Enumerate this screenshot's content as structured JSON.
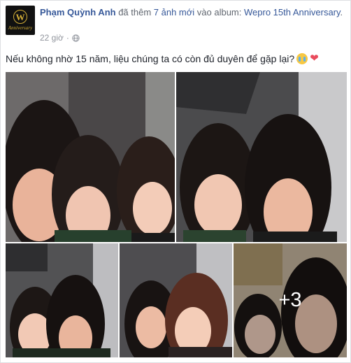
{
  "post": {
    "author": "Phạm Quỳnh Anh",
    "action_text": " đã thêm ",
    "photo_count_link": "7 ảnh mới",
    "preposition": " vào album: ",
    "album_name": "Wepro 15th Anniversary",
    "album_suffix": ".",
    "timestamp": "22 giờ",
    "separator": "·",
    "privacy_icon": "globe-icon",
    "caption": "Nếu không nhờ 15 năm, liệu chúng ta có còn đủ duyên để gặp lại?",
    "caption_emojis": [
      "crying-face-icon",
      "heart-icon"
    ],
    "heart_glyph": "❤",
    "avatar_logo": {
      "monogram": "W",
      "script": "Anniversary"
    },
    "more_photos": "+3"
  },
  "colors": {
    "link": "#365899",
    "meta": "#90949c",
    "text": "#1d2129",
    "accent_gold": "#d4af37"
  }
}
